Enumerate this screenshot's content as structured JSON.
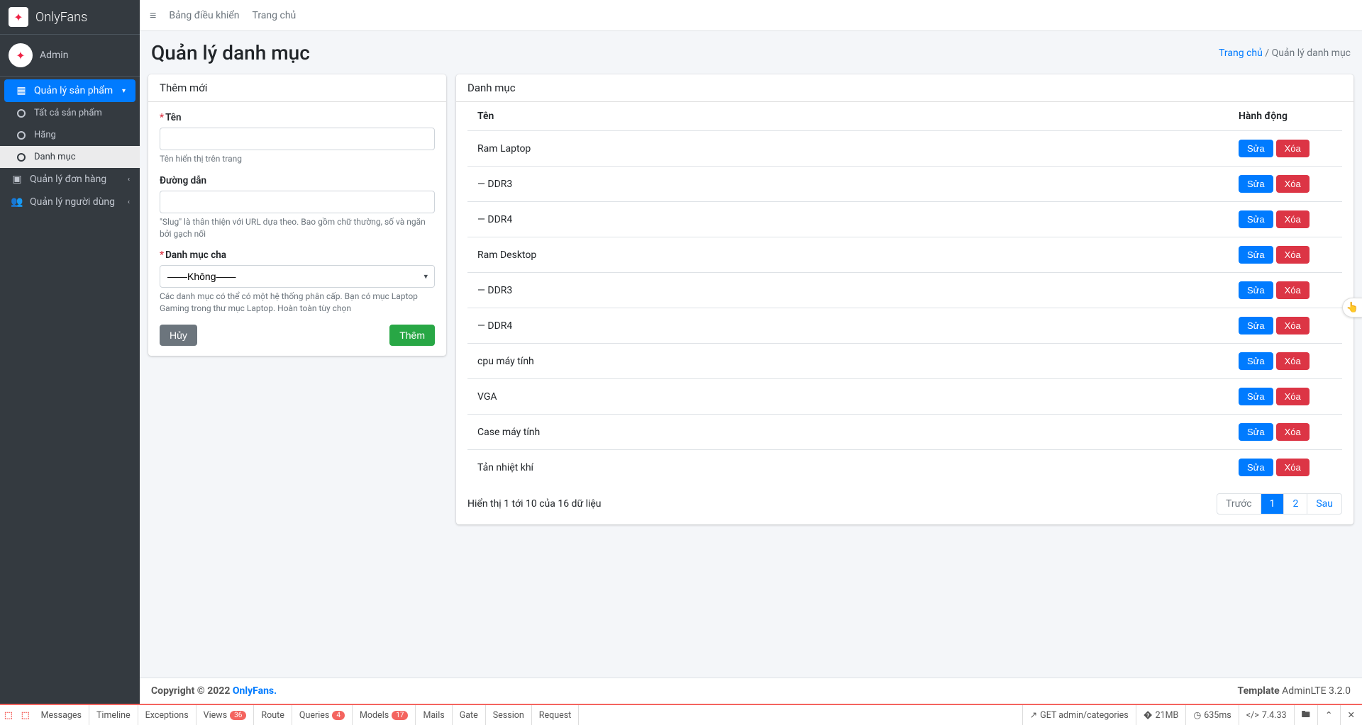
{
  "brand": {
    "name": "OnlyFans"
  },
  "user": {
    "name": "Admin"
  },
  "sidebar": {
    "products": {
      "label": "Quản lý sản phẩm",
      "all": "Tất cả sản phẩm",
      "brands": "Hãng",
      "categories": "Danh mục"
    },
    "orders": "Quản lý đơn hàng",
    "users": "Quản lý người dùng"
  },
  "topnav": {
    "dashboard": "Bảng điều khiển",
    "home": "Trang chủ"
  },
  "header": {
    "title": "Quản lý danh mục",
    "breadcrumb_home": "Trang chủ",
    "breadcrumb_current": "Quản lý danh mục"
  },
  "form": {
    "card_title": "Thêm mới",
    "name_label": "Tên",
    "name_help": "Tên hiển thị trên trang",
    "slug_label": "Đường dẫn",
    "slug_help": "\"Slug\" là thân thiện với URL dựa theo. Bao gồm chữ thường, số và ngăn bởi gạch nối",
    "parent_label": "Danh mục cha",
    "parent_selected": "——Không——",
    "parent_help": "Các danh mục có thể có một hệ thống phân cấp. Bạn có mục Laptop Gaming trong thư mục Laptop. Hoàn toàn tùy chọn",
    "cancel": "Hủy",
    "submit": "Thêm"
  },
  "table": {
    "card_title": "Danh mục",
    "col_name": "Tên",
    "col_actions": "Hành động",
    "edit": "Sửa",
    "delete": "Xóa",
    "rows": [
      {
        "name": "Ram Laptop"
      },
      {
        "name": "— DDR3"
      },
      {
        "name": "— DDR4"
      },
      {
        "name": "Ram Desktop"
      },
      {
        "name": "— DDR3"
      },
      {
        "name": "— DDR4"
      },
      {
        "name": "cpu máy tính"
      },
      {
        "name": "VGA"
      },
      {
        "name": "Case máy tính"
      },
      {
        "name": "Tản nhiệt khí"
      }
    ],
    "footer_info": "Hiển thị 1 tới 10 của 16 dữ liệu",
    "pagination": {
      "prev": "Trước",
      "p1": "1",
      "p2": "2",
      "next": "Sau"
    }
  },
  "footer": {
    "copyright_prefix": "Copyright © 2022 ",
    "brand": "OnlyFans.",
    "template_prefix": "Template ",
    "template": "AdminLTE 3.2.0"
  },
  "debugbar": {
    "messages": "Messages",
    "timeline": "Timeline",
    "exceptions": "Exceptions",
    "views": "Views",
    "views_count": "36",
    "route": "Route",
    "queries": "Queries",
    "queries_count": "4",
    "models": "Models",
    "models_count": "17",
    "mails": "Mails",
    "gate": "Gate",
    "session": "Session",
    "request": "Request",
    "method_path": "GET admin/categories",
    "memory": "21MB",
    "time": "635ms",
    "php": "7.4.33"
  }
}
